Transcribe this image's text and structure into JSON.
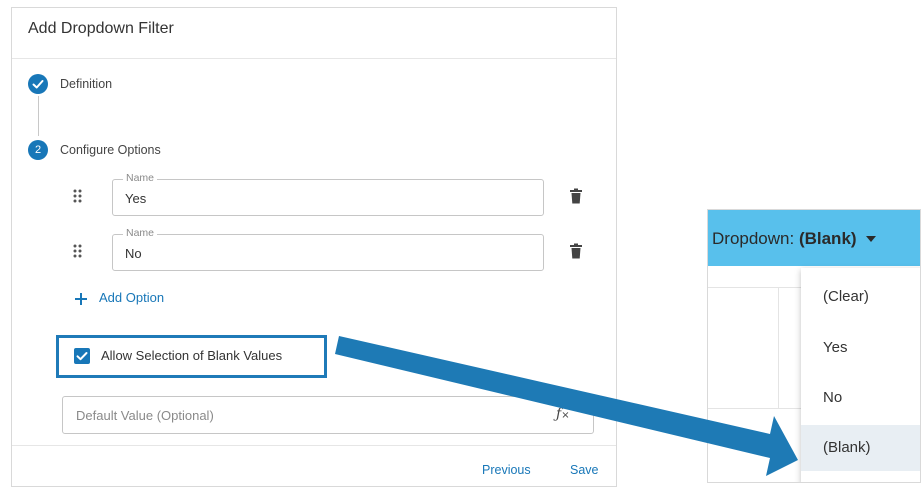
{
  "dialog": {
    "title": "Add Dropdown Filter",
    "steps": [
      {
        "number": "",
        "label": "Definition",
        "state": "completed"
      },
      {
        "number": "2",
        "label": "Configure Options",
        "state": "active"
      }
    ],
    "options": [
      {
        "legend": "Name",
        "value": "Yes"
      },
      {
        "legend": "Name",
        "value": "No"
      }
    ],
    "add_option_label": "Add Option",
    "allow_blank": {
      "label": "Allow Selection of Blank Values",
      "checked": true
    },
    "default_value": {
      "placeholder": "Default Value (Optional)",
      "icon": "function-clear-icon"
    },
    "footer": {
      "previous_label": "Previous",
      "save_label": "Save"
    }
  },
  "preview": {
    "label_prefix": "Dropdown: ",
    "selected": "(Blank)",
    "menu_items": [
      "(Clear)",
      "Yes",
      "No",
      "(Blank)"
    ],
    "highlighted_item": "(Blank)"
  },
  "colors": {
    "accent": "#1877b8",
    "highlight_box": "#1f7ab8",
    "preview_bar": "#58c0ec",
    "arrow": "#1e7ab5"
  }
}
